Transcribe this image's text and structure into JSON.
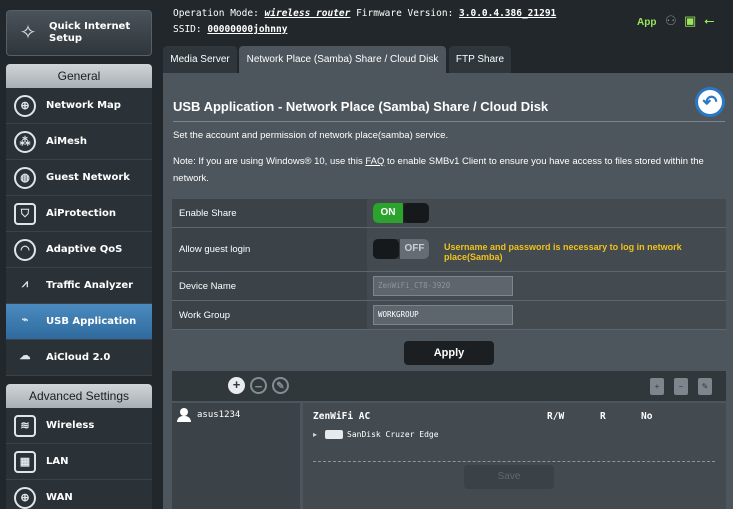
{
  "sidebar": {
    "quick_setup": "Quick Internet Setup",
    "general_header": "General",
    "general_items": [
      {
        "label": "Network Map",
        "icon": "globe-icon"
      },
      {
        "label": "AiMesh",
        "icon": "mesh-icon"
      },
      {
        "label": "Guest Network",
        "icon": "guest-network-icon"
      },
      {
        "label": "AiProtection",
        "icon": "shield-icon"
      },
      {
        "label": "Adaptive QoS",
        "icon": "gauge-icon"
      },
      {
        "label": "Traffic Analyzer",
        "icon": "traffic-icon"
      },
      {
        "label": "USB Application",
        "icon": "usb-icon",
        "active": true
      },
      {
        "label": "AiCloud 2.0",
        "icon": "cloud-icon"
      }
    ],
    "advanced_header": "Advanced Settings",
    "advanced_items": [
      {
        "label": "Wireless",
        "icon": "wifi-icon"
      },
      {
        "label": "LAN",
        "icon": "lan-icon"
      },
      {
        "label": "WAN",
        "icon": "wan-globe-icon"
      }
    ]
  },
  "header": {
    "op_mode_label": "Operation Mode:",
    "op_mode_value": "wireless router",
    "fw_label": "Firmware Version:",
    "fw_value": "3.0.0.4.386_21291",
    "ssid_label": "SSID:",
    "ssid_value": "00000000johnny",
    "app_label": "App"
  },
  "tabs": [
    "Media Server",
    "Network Place (Samba) Share / Cloud Disk",
    "FTP Share"
  ],
  "content": {
    "title": "USB Application - Network Place (Samba) Share / Cloud Disk",
    "desc": "Set the account and permission of network place(samba) service.",
    "note_before": "Note: If you are using Windows® 10, use this ",
    "note_link": "FAQ",
    "note_after": " to enable SMBv1 Client to ensure you have access to files stored within the network."
  },
  "settings": {
    "enable_share_label": "Enable Share",
    "enable_share_state": "ON",
    "guest_login_label": "Allow guest login",
    "guest_login_state": "OFF",
    "guest_warning": "Username and password is necessary to log in network place(Samba)",
    "device_name_label": "Device Name",
    "device_name_value": "ZenWiFi_CT8-3920",
    "work_group_label": "Work Group",
    "work_group_value": "WORKGROUP",
    "apply_label": "Apply"
  },
  "accounts": {
    "users": [
      "asus1234"
    ],
    "device_label": "ZenWiFi AC",
    "perm_rw": "R/W",
    "perm_r": "R",
    "perm_no": "No",
    "drive_name": "SanDisk Cruzer Edge",
    "save_label": "Save"
  },
  "colors": {
    "accent": "#2a78c4",
    "on_green": "#2ca32c",
    "warning": "#f0c21a",
    "app_green": "#9be65a"
  }
}
